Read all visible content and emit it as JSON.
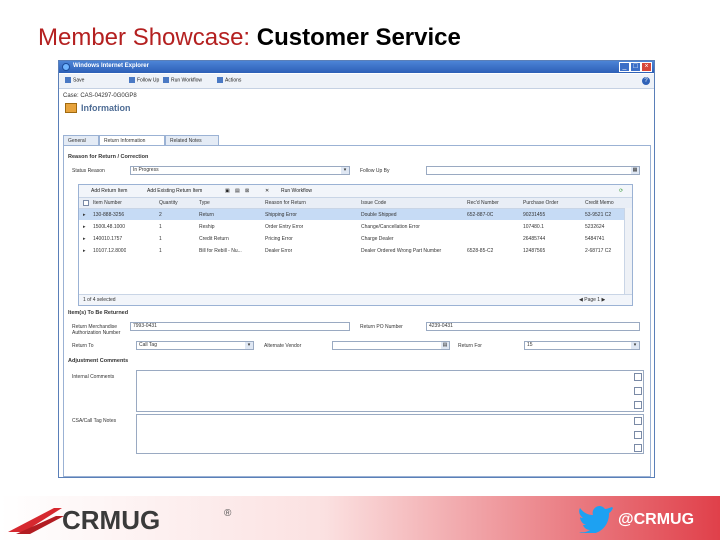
{
  "slide": {
    "title_prefix": "Member Showcase: ",
    "title_main": "Customer Service"
  },
  "window": {
    "title": "Windows Internet Explorer",
    "min": "_",
    "max": "□",
    "close": "×",
    "help": "?"
  },
  "toolbar": {
    "items": [
      "Save",
      "Follow Up",
      "Run Workflow",
      "Actions"
    ]
  },
  "case": {
    "number": "Case: CAS-04297-0G0GP8",
    "form_title": "Information"
  },
  "tabs": [
    "General",
    "Return Information",
    "Related Notes"
  ],
  "returns_section": {
    "header": "Reason for Return / Correction",
    "status_reason_label": "Status Reason",
    "status_reason_value": "In Progress",
    "follow_up_label": "Follow Up By"
  },
  "grid": {
    "toolbar": [
      "Add Return Item",
      "Add Existing Return Item",
      "Run Workflow"
    ],
    "columns": [
      "Item Number",
      "Quantity",
      "Type",
      "Reason for Return",
      "Issue Code",
      "Rec'd Number",
      "Purchase Order",
      "Credit Memo"
    ],
    "rows": [
      {
        "item": "130-888-3256",
        "qty": "2",
        "type": "Return",
        "reason": "Shipping Error",
        "issue": "Double Shipped",
        "recd": "652-887-0C",
        "po": "90231455",
        "cm": "53-9521 C2",
        "selected": true
      },
      {
        "item": "1500L48.1000",
        "qty": "1",
        "type": "Reship",
        "reason": "Order Entry Error",
        "issue": "Change/Cancellation Error",
        "recd": "",
        "po": "107480.1",
        "cm": "5232624",
        "selected": false
      },
      {
        "item": "140010.1757",
        "qty": "1",
        "type": "Credit Return",
        "reason": "Pricing Error",
        "issue": "Charge Dealer",
        "recd": "",
        "po": "26485744",
        "cm": "5484741",
        "selected": false
      },
      {
        "item": "10107.12.8000",
        "qty": "1",
        "type": "Bill for Rebill - Nu...",
        "reason": "Dealer Error",
        "issue": "Dealer Ordered Wrong Part Number",
        "recd": "6528-85-C2",
        "po": "12487565",
        "cm": "2-68717 C2",
        "selected": false
      }
    ],
    "footer_left": "1 of 4 selected",
    "footer_right": "◀ Page 1 ▶"
  },
  "items_section": {
    "header": "Item(s) To Be Returned",
    "rma_label": "Return Merchandise Authorization Number",
    "rma_value": "7993-0431",
    "po_label": "Return PO Number",
    "po_value": "4239-0431",
    "return_to_label": "Return To",
    "return_to_value": "Call Tag",
    "alt_vendor_label": "Alternate Vendor",
    "return_for_label": "Return For",
    "return_for_value": "15"
  },
  "adjustment": {
    "header": "Adjustment Comments",
    "internal_label": "Internal Comments",
    "csa_label": "CSA/Call Tag Notes"
  },
  "footer": {
    "logo_text": "CRMUG",
    "registered": "®",
    "handle": "@CRMUG"
  },
  "colors": {
    "title_red": "#b42020",
    "brand_red": "#e0404a",
    "twitter_blue": "#1da1f2"
  }
}
